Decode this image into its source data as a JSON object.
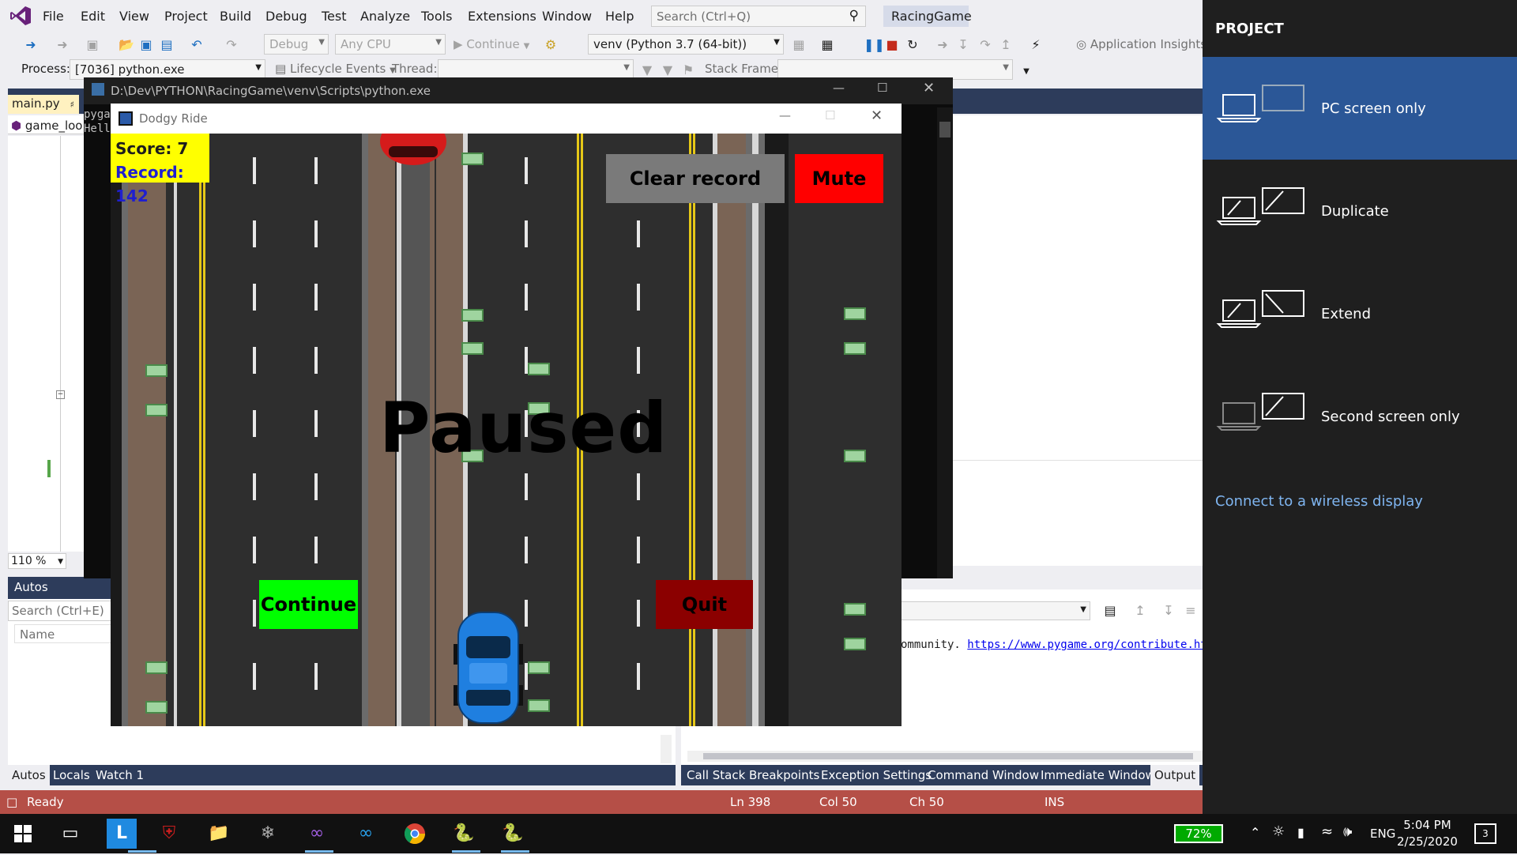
{
  "menu": {
    "items": [
      "File",
      "Edit",
      "View",
      "Project",
      "Build",
      "Debug",
      "Test",
      "Analyze",
      "Tools",
      "Extensions",
      "Window",
      "Help"
    ],
    "search_placeholder": "Search (Ctrl+Q)",
    "project_name": "RacingGame"
  },
  "toolbar": {
    "config": "Debug",
    "platform": "Any CPU",
    "continue_label": "Continue",
    "environment": "venv (Python 3.7 (64-bit))",
    "app_insights": "Application Insights",
    "process_label": "Process:",
    "process_value": "[7036] python.exe",
    "lifecycle_label": "Lifecycle Events",
    "thread_label": "Thread:",
    "stack_frame_label": "Stack Frame:"
  },
  "editor": {
    "tab_label": "main.py",
    "nav_label": "game_loo",
    "zoom": "110 %",
    "console_line1": "pyga",
    "console_line2": "Hell"
  },
  "console": {
    "title": "D:\\Dev\\PYTHON\\RacingGame\\venv\\Scripts\\python.exe"
  },
  "game": {
    "window_title": "Dodgy Ride",
    "score_label": "Score: 7",
    "record_label": "Record: 142",
    "clear_record": "Clear record",
    "mute": "Mute",
    "paused": "Paused",
    "continue": "Continue",
    "quit": "Quit"
  },
  "autos": {
    "header": "Autos",
    "search_placeholder": "Search (Ctrl+E)",
    "col_name": "Name",
    "tabs": [
      "Autos",
      "Locals",
      "Watch 1"
    ]
  },
  "output": {
    "text": "ommunity. ",
    "link": "https://www.pygame.org/contribute.html",
    "tabs": [
      "Call Stack",
      "Breakpoints",
      "Exception Settings",
      "Command Window",
      "Immediate Window",
      "Output"
    ]
  },
  "status": {
    "ready": "Ready",
    "ln": "Ln 398",
    "col": "Col 50",
    "ch": "Ch 50",
    "ins": "INS"
  },
  "project_pane": {
    "header": "PROJECT",
    "options": [
      "PC screen only",
      "Duplicate",
      "Extend",
      "Second screen only"
    ],
    "selected": "PC screen only",
    "link": "Connect to a wireless display"
  },
  "taskbar": {
    "battery": "72%",
    "lang": "ENG",
    "time": "5:04 PM",
    "date": "2/25/2020",
    "notifications": "3"
  },
  "colors": {
    "vs_accent": "#68217a",
    "status_bar": "#b54f47",
    "project_selected": "#2b5797",
    "score_bg": "#ffff00",
    "mute_bg": "#ff0000",
    "continue_bg": "#00ff00",
    "quit_bg": "#8b0000",
    "clear_bg": "#7a7a7a"
  }
}
